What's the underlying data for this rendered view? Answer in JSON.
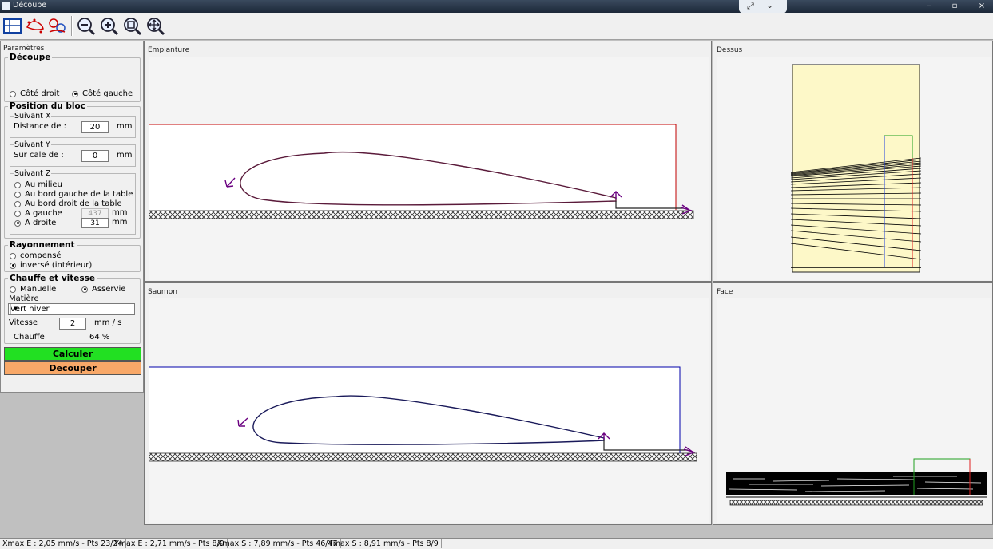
{
  "window": {
    "title": "Découpe"
  },
  "toolbar": {
    "buttons": [
      {
        "name": "view-grid-button",
        "icon": "grid-view-icon"
      },
      {
        "name": "profile-edit-button",
        "icon": "airfoil-edit-icon"
      },
      {
        "name": "profile-link-button",
        "icon": "airfoil-link-icon"
      },
      {
        "name": "zoom-out-button",
        "icon": "zoom-out-icon"
      },
      {
        "name": "zoom-in-button",
        "icon": "zoom-in-icon"
      },
      {
        "name": "zoom-fit-button",
        "icon": "zoom-fit-icon"
      },
      {
        "name": "pan-button",
        "icon": "pan-icon"
      }
    ]
  },
  "params": {
    "panel_title": "Paramètres",
    "decoupe": {
      "title": "Découpe",
      "options": [
        {
          "label": "Côté droit",
          "checked": false
        },
        {
          "label": "Côté gauche",
          "checked": true
        }
      ]
    },
    "position": {
      "title": "Position du bloc",
      "x": {
        "title": "Suivant X",
        "label": "Distance de :",
        "value": "20",
        "unit": "mm"
      },
      "y": {
        "title": "Suivant Y",
        "label": "Sur cale de :",
        "value": "0",
        "unit": "mm"
      },
      "z": {
        "title": "Suivant Z",
        "options": [
          {
            "label": "Au milieu",
            "checked": false
          },
          {
            "label": "Au bord gauche de la table",
            "checked": false
          },
          {
            "label": "Au bord droit de la table",
            "checked": false
          },
          {
            "label": "A gauche",
            "checked": false,
            "value": "437",
            "unit": "mm"
          },
          {
            "label": "A droite",
            "checked": true,
            "value": "31",
            "unit": "mm"
          }
        ]
      }
    },
    "rayonnement": {
      "title": "Rayonnement",
      "options": [
        {
          "label": "compensé",
          "checked": false
        },
        {
          "label": "inversé (intérieur)",
          "checked": true
        }
      ]
    },
    "chauffe": {
      "title": "Chauffe et vitesse",
      "options": [
        {
          "label": "Manuelle",
          "checked": false
        },
        {
          "label": "Asservie",
          "checked": true
        }
      ],
      "matiere_label": "Matière",
      "matiere_value": "vert hiver",
      "vitesse_label": "Vitesse",
      "vitesse_value": "2",
      "vitesse_unit": "mm / s",
      "chauffe_label": "Chauffe",
      "chauffe_value": "64 %"
    },
    "calculer": "Calculer",
    "decouper": "Decouper"
  },
  "panes": {
    "emplanture": "Emplanture",
    "dessus": "Dessus",
    "saumon": "Saumon",
    "face": "Face"
  },
  "colors": {
    "emplanture_outline": "#c00000",
    "saumon_outline": "#0000aa",
    "path_arrow": "#6a0080",
    "dessus_fill": "#fdf8c8",
    "calc_button": "#22e022",
    "decouper_button": "#f8a868"
  },
  "status": {
    "segments": [
      "Xmax E : 2,05 mm/s - Pts 23/24",
      "Ymax E : 2,71 mm/s - Pts 8/9",
      "Xmax S : 7,89 mm/s - Pts 46/47",
      "Ymax S : 8,91 mm/s - Pts 8/9"
    ]
  }
}
